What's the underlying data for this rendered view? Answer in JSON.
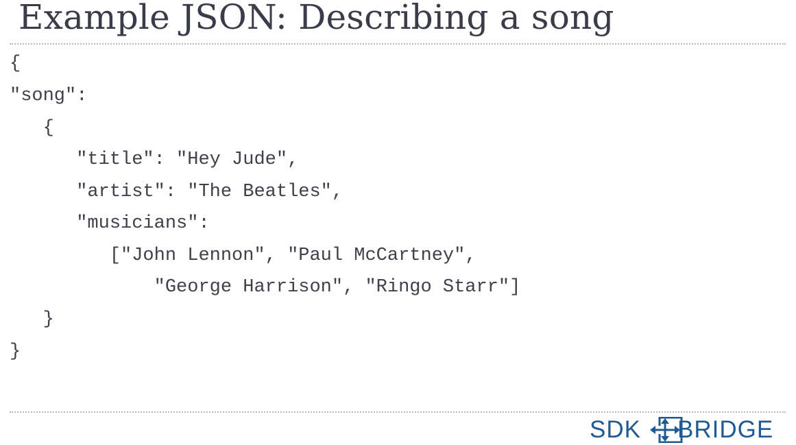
{
  "slide": {
    "title": "Example JSON: Describing a song"
  },
  "code": {
    "lines": [
      "{",
      "\"song\":",
      "   {",
      "      \"title\": \"Hey Jude\",",
      "      \"artist\": \"The Beatles\",",
      "      \"musicians\":",
      "         [\"John Lennon\", \"Paul McCartney\",",
      "             \"George Harrison\", \"Ringo Starr\"]",
      "   }",
      "}"
    ]
  },
  "logo": {
    "text_left": "SDK",
    "text_right": "BRIDGE",
    "icon": "bridge-arrows-icon",
    "color": "#1f5a92"
  }
}
